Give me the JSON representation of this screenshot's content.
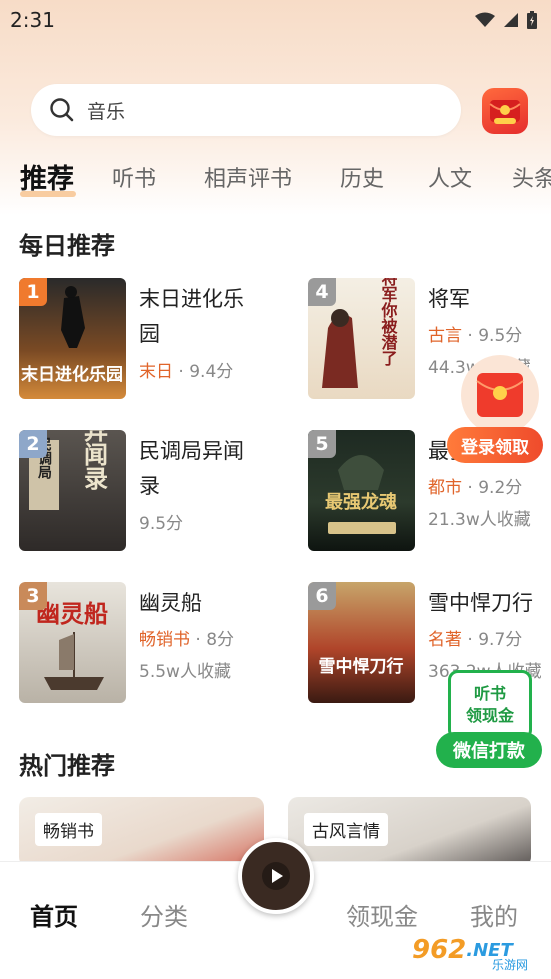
{
  "status_bar": {
    "time": "2:31"
  },
  "search": {
    "placeholder": "音乐"
  },
  "tabs": [
    {
      "label": "推荐",
      "active": true
    },
    {
      "label": "听书",
      "active": false
    },
    {
      "label": "相声评书",
      "active": false
    },
    {
      "label": "历史",
      "active": false
    },
    {
      "label": "人文",
      "active": false
    },
    {
      "label": "头条",
      "active": false
    }
  ],
  "daily": {
    "title": "每日推荐",
    "books": [
      {
        "rank": "1",
        "title": "末日进化乐园",
        "tag": "末日",
        "score": "9.4分",
        "sub": ""
      },
      {
        "rank": "4",
        "title": "将军",
        "tag": "古言",
        "score": "9.5分",
        "sub": "44.3w人收藏"
      },
      {
        "rank": "2",
        "title": "民调局异闻录",
        "tag": "",
        "score": "9.5分",
        "sub": ""
      },
      {
        "rank": "5",
        "title": "最强龙魂",
        "tag": "都市",
        "score": "9.2分",
        "sub": "21.3w人收藏"
      },
      {
        "rank": "3",
        "title": "幽灵船",
        "tag": "畅销书",
        "score": "8分",
        "sub": "5.5w人收藏"
      },
      {
        "rank": "6",
        "title": "雪中悍刀行",
        "tag": "名著",
        "score": "9.7分",
        "sub": "363.2w人收藏"
      }
    ],
    "cover_texts": {
      "book1": "末日进化乐园",
      "book4": "将军你被潜了",
      "book2a": "民调局",
      "book2b": "异闻录",
      "book5": "最强龙魂",
      "book3": "幽灵船",
      "book6": "雪中悍刀行"
    }
  },
  "hot": {
    "title": "热门推荐",
    "cards": [
      {
        "label": "畅销书"
      },
      {
        "label": "古风言情"
      }
    ]
  },
  "float_login": {
    "label": "登录领取"
  },
  "float_cash": {
    "line1": "听书",
    "line2": "领现金",
    "button": "微信打款"
  },
  "bottom_nav": {
    "home": "首页",
    "category": "分类",
    "cash": "领现金",
    "mine": "我的"
  },
  "watermark": {
    "num": "962",
    "net": ".NET",
    "sub": "乐游网"
  },
  "colors": {
    "accent_orange": "#e0642a",
    "green": "#22b14c",
    "red": "#ef4b2c"
  }
}
